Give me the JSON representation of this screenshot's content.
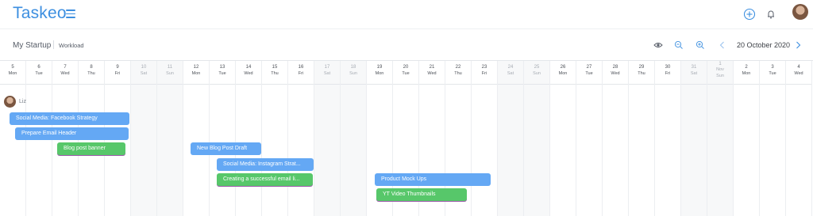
{
  "app": {
    "title": "Taskeo"
  },
  "breadcrumb": {
    "project": "My Startup",
    "view": "Workload"
  },
  "toolbar": {
    "date": "20 October 2020"
  },
  "assignee": {
    "name": "Liz"
  },
  "days": [
    {
      "num": "5",
      "day": "Mon",
      "weekend": false
    },
    {
      "num": "6",
      "day": "Tue",
      "weekend": false
    },
    {
      "num": "7",
      "day": "Wed",
      "weekend": false
    },
    {
      "num": "8",
      "day": "Thu",
      "weekend": false
    },
    {
      "num": "9",
      "day": "Fri",
      "weekend": false
    },
    {
      "num": "10",
      "day": "Sat",
      "weekend": true
    },
    {
      "num": "11",
      "day": "Sun",
      "weekend": true
    },
    {
      "num": "12",
      "day": "Mon",
      "weekend": false
    },
    {
      "num": "13",
      "day": "Tue",
      "weekend": false
    },
    {
      "num": "14",
      "day": "Wed",
      "weekend": false
    },
    {
      "num": "15",
      "day": "Thu",
      "weekend": false
    },
    {
      "num": "16",
      "day": "Fri",
      "weekend": false
    },
    {
      "num": "17",
      "day": "Sat",
      "weekend": true
    },
    {
      "num": "18",
      "day": "Sun",
      "weekend": true
    },
    {
      "num": "19",
      "day": "Mon",
      "weekend": false
    },
    {
      "num": "20",
      "day": "Tue",
      "weekend": false
    },
    {
      "num": "21",
      "day": "Wed",
      "weekend": false
    },
    {
      "num": "22",
      "day": "Thu",
      "weekend": false
    },
    {
      "num": "23",
      "day": "Fri",
      "weekend": false
    },
    {
      "num": "24",
      "day": "Sat",
      "weekend": true
    },
    {
      "num": "25",
      "day": "Sun",
      "weekend": true
    },
    {
      "num": "26",
      "day": "Mon",
      "weekend": false
    },
    {
      "num": "27",
      "day": "Tue",
      "weekend": false
    },
    {
      "num": "28",
      "day": "Wed",
      "weekend": false
    },
    {
      "num": "29",
      "day": "Thu",
      "weekend": false
    },
    {
      "num": "30",
      "day": "Fri",
      "weekend": false
    },
    {
      "num": "31",
      "day": "Sat",
      "weekend": true
    },
    {
      "num": "1",
      "month": "Nov",
      "day": "Sun",
      "weekend": true
    },
    {
      "num": "2",
      "day": "Mon",
      "weekend": false
    },
    {
      "num": "3",
      "day": "Tue",
      "weekend": false
    },
    {
      "num": "4",
      "day": "Wed",
      "weekend": false
    }
  ],
  "tasks": [
    {
      "label": "Social Media: Facebook Strategy",
      "color": "blue"
    },
    {
      "label": "Prepare Email Header",
      "color": "blue"
    },
    {
      "label": "Blog post banner",
      "color": "green"
    },
    {
      "label": "New Blog Post Draft",
      "color": "blue"
    },
    {
      "label": "Social Media: Instagram Strat...",
      "color": "blue"
    },
    {
      "label": "Creating a successful email li...",
      "color": "green"
    },
    {
      "label": "Product Mock Ups",
      "color": "blue"
    },
    {
      "label": "YT Video Thumbnails",
      "color": "green"
    }
  ],
  "colors": {
    "brand": "#3d8fe0",
    "task_blue": "#64a8f4",
    "task_green": "#57c76a"
  },
  "icons": [
    "menu-icon",
    "add-circle-icon",
    "bell-icon",
    "eye-icon",
    "zoom-out-icon",
    "zoom-in-icon",
    "chevron-left-icon",
    "chevron-right-icon"
  ]
}
